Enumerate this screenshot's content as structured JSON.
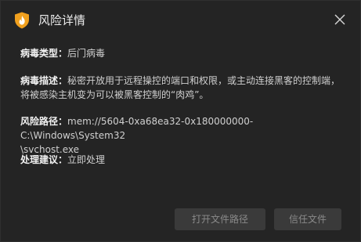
{
  "window": {
    "title": "风险详情",
    "accent_color": "#f0a01e"
  },
  "details": {
    "virus_type_label": "病毒类型：",
    "virus_type_value": "后门病毒",
    "description_label": "病毒描述：",
    "description_line1": "秘密开放用于远程操控的端口和权限，或主动连接黑客的控制端，",
    "description_line2": "将被感染主机变为可以被黑客控制的“肉鸡”。",
    "path_label": "风险路径：",
    "path_line1": "mem://5604-0xa68ea32-0x180000000-C:\\Windows\\System32",
    "path_line2": "\\svchost.exe",
    "advice_label": "处理建议：",
    "advice_value": "立即处理"
  },
  "buttons": {
    "open_path": "打开文件路径",
    "trust_file": "信任文件"
  }
}
